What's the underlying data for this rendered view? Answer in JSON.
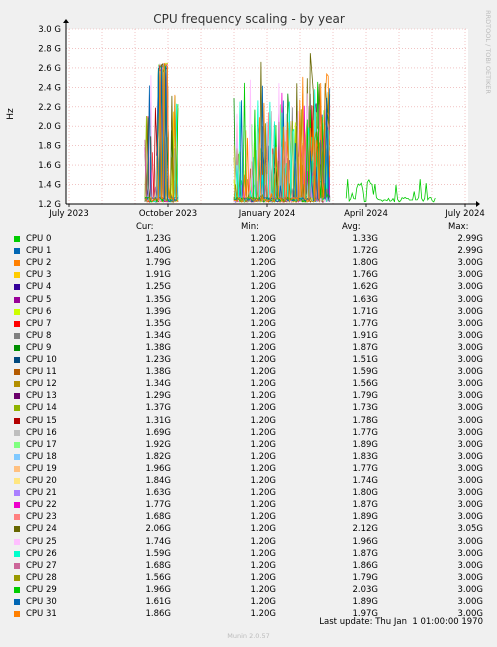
{
  "chart_data": {
    "type": "line",
    "title": "CPU frequency scaling - by year",
    "ylabel": "Hz",
    "side_label": "RRDTOOL / TOBI OETIKER",
    "ylim": [
      1.2,
      3.0
    ],
    "yticks": [
      "1.2 G",
      "1.4 G",
      "1.6 G",
      "1.8 G",
      "2.0 G",
      "2.2 G",
      "2.4 G",
      "2.6 G",
      "2.8 G",
      "3.0 G"
    ],
    "xticks": [
      "July 2023",
      "October 2023",
      "January 2024",
      "April 2024",
      "July 2024"
    ],
    "grid": true,
    "columns": [
      "Cur:",
      "Min:",
      "Avg:",
      "Max:"
    ],
    "series": [
      {
        "name": "CPU 0",
        "color": "#00cc00",
        "cur": "1.23G",
        "min": "1.20G",
        "avg": "1.33G",
        "max": "2.99G"
      },
      {
        "name": "CPU 1",
        "color": "#0066b3",
        "cur": "1.40G",
        "min": "1.20G",
        "avg": "1.72G",
        "max": "2.99G"
      },
      {
        "name": "CPU 2",
        "color": "#ff8000",
        "cur": "1.79G",
        "min": "1.20G",
        "avg": "1.80G",
        "max": "3.00G"
      },
      {
        "name": "CPU 3",
        "color": "#ffcc00",
        "cur": "1.91G",
        "min": "1.20G",
        "avg": "1.76G",
        "max": "3.00G"
      },
      {
        "name": "CPU 4",
        "color": "#330099",
        "cur": "1.25G",
        "min": "1.20G",
        "avg": "1.62G",
        "max": "3.00G"
      },
      {
        "name": "CPU 5",
        "color": "#990099",
        "cur": "1.35G",
        "min": "1.20G",
        "avg": "1.63G",
        "max": "3.00G"
      },
      {
        "name": "CPU 6",
        "color": "#ccff00",
        "cur": "1.39G",
        "min": "1.20G",
        "avg": "1.71G",
        "max": "3.00G"
      },
      {
        "name": "CPU 7",
        "color": "#ff0000",
        "cur": "1.35G",
        "min": "1.20G",
        "avg": "1.77G",
        "max": "3.00G"
      },
      {
        "name": "CPU 8",
        "color": "#808080",
        "cur": "1.34G",
        "min": "1.20G",
        "avg": "1.91G",
        "max": "3.00G"
      },
      {
        "name": "CPU 9",
        "color": "#008f00",
        "cur": "1.38G",
        "min": "1.20G",
        "avg": "1.87G",
        "max": "3.00G"
      },
      {
        "name": "CPU 10",
        "color": "#00487d",
        "cur": "1.23G",
        "min": "1.20G",
        "avg": "1.51G",
        "max": "3.00G"
      },
      {
        "name": "CPU 11",
        "color": "#b35a00",
        "cur": "1.38G",
        "min": "1.20G",
        "avg": "1.59G",
        "max": "3.00G"
      },
      {
        "name": "CPU 12",
        "color": "#b38f00",
        "cur": "1.34G",
        "min": "1.20G",
        "avg": "1.56G",
        "max": "3.00G"
      },
      {
        "name": "CPU 13",
        "color": "#6b006b",
        "cur": "1.29G",
        "min": "1.20G",
        "avg": "1.79G",
        "max": "3.00G"
      },
      {
        "name": "CPU 14",
        "color": "#8fb300",
        "cur": "1.37G",
        "min": "1.20G",
        "avg": "1.73G",
        "max": "3.00G"
      },
      {
        "name": "CPU 15",
        "color": "#b30000",
        "cur": "1.31G",
        "min": "1.20G",
        "avg": "1.78G",
        "max": "3.00G"
      },
      {
        "name": "CPU 16",
        "color": "#bebebe",
        "cur": "1.69G",
        "min": "1.20G",
        "avg": "1.77G",
        "max": "3.00G"
      },
      {
        "name": "CPU 17",
        "color": "#80ff80",
        "cur": "1.92G",
        "min": "1.20G",
        "avg": "1.89G",
        "max": "3.00G"
      },
      {
        "name": "CPU 18",
        "color": "#80c9ff",
        "cur": "1.82G",
        "min": "1.20G",
        "avg": "1.83G",
        "max": "3.00G"
      },
      {
        "name": "CPU 19",
        "color": "#ffc080",
        "cur": "1.96G",
        "min": "1.20G",
        "avg": "1.77G",
        "max": "3.00G"
      },
      {
        "name": "CPU 20",
        "color": "#ffe680",
        "cur": "1.84G",
        "min": "1.20G",
        "avg": "1.74G",
        "max": "3.00G"
      },
      {
        "name": "CPU 21",
        "color": "#aa80ff",
        "cur": "1.63G",
        "min": "1.20G",
        "avg": "1.80G",
        "max": "3.00G"
      },
      {
        "name": "CPU 22",
        "color": "#ee00cc",
        "cur": "1.77G",
        "min": "1.20G",
        "avg": "1.87G",
        "max": "3.00G"
      },
      {
        "name": "CPU 23",
        "color": "#ff8080",
        "cur": "1.68G",
        "min": "1.20G",
        "avg": "1.89G",
        "max": "3.00G"
      },
      {
        "name": "CPU 24",
        "color": "#666600",
        "cur": "2.06G",
        "min": "1.20G",
        "avg": "2.12G",
        "max": "3.05G"
      },
      {
        "name": "CPU 25",
        "color": "#ffbfff",
        "cur": "1.74G",
        "min": "1.20G",
        "avg": "1.96G",
        "max": "3.00G"
      },
      {
        "name": "CPU 26",
        "color": "#00ffcc",
        "cur": "1.59G",
        "min": "1.20G",
        "avg": "1.87G",
        "max": "3.00G"
      },
      {
        "name": "CPU 27",
        "color": "#cc6699",
        "cur": "1.68G",
        "min": "1.20G",
        "avg": "1.86G",
        "max": "3.00G"
      },
      {
        "name": "CPU 28",
        "color": "#999900",
        "cur": "1.56G",
        "min": "1.20G",
        "avg": "1.79G",
        "max": "3.00G"
      },
      {
        "name": "CPU 29",
        "color": "#00cc00",
        "cur": "1.96G",
        "min": "1.20G",
        "avg": "2.03G",
        "max": "3.00G"
      },
      {
        "name": "CPU 30",
        "color": "#0066b3",
        "cur": "1.61G",
        "min": "1.20G",
        "avg": "1.89G",
        "max": "3.00G"
      },
      {
        "name": "CPU 31",
        "color": "#ff8000",
        "cur": "1.86G",
        "min": "1.20G",
        "avg": "1.97G",
        "max": "3.00G"
      }
    ],
    "last_update": "Last update: Thu Jan  1 01:00:00 1970",
    "footer": "Munin 2.0.57"
  }
}
